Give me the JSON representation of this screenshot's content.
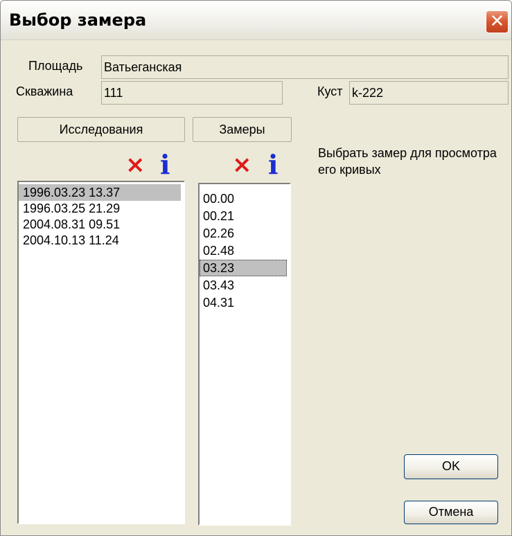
{
  "window": {
    "title": "Выбор замера",
    "close_glyph": "✕"
  },
  "area": {
    "label": "Площадь",
    "value": "Ватьеганская"
  },
  "well": {
    "label": "Скважина",
    "value": "111"
  },
  "pad": {
    "label": "Куст",
    "value": "k-222"
  },
  "studies": {
    "header": "Исследования",
    "delete_icon": "×",
    "info_icon": "i",
    "items": [
      "1996.03.23 13.37",
      "1996.03.25 21.29",
      "2004.08.31 09.51",
      "2004.10.13 11.24"
    ],
    "selected_index": 0
  },
  "measurements": {
    "header": "Замеры",
    "delete_icon": "×",
    "info_icon": "i",
    "items": [
      "00.00",
      "00.21",
      "02.26",
      "02.48",
      "03.23",
      "03.43",
      "04.31"
    ],
    "selected_index": 4
  },
  "hint": "Выбрать замер для просмотра его кривых",
  "buttons": {
    "ok": "OK",
    "cancel": "Отмена"
  },
  "colors": {
    "delete_icon": "#e01a1a",
    "info_icon": "#1a2fd0",
    "close_button": "#d8552d",
    "selection": "#c0c0c0",
    "dialog_bg": "#ece9d8"
  }
}
